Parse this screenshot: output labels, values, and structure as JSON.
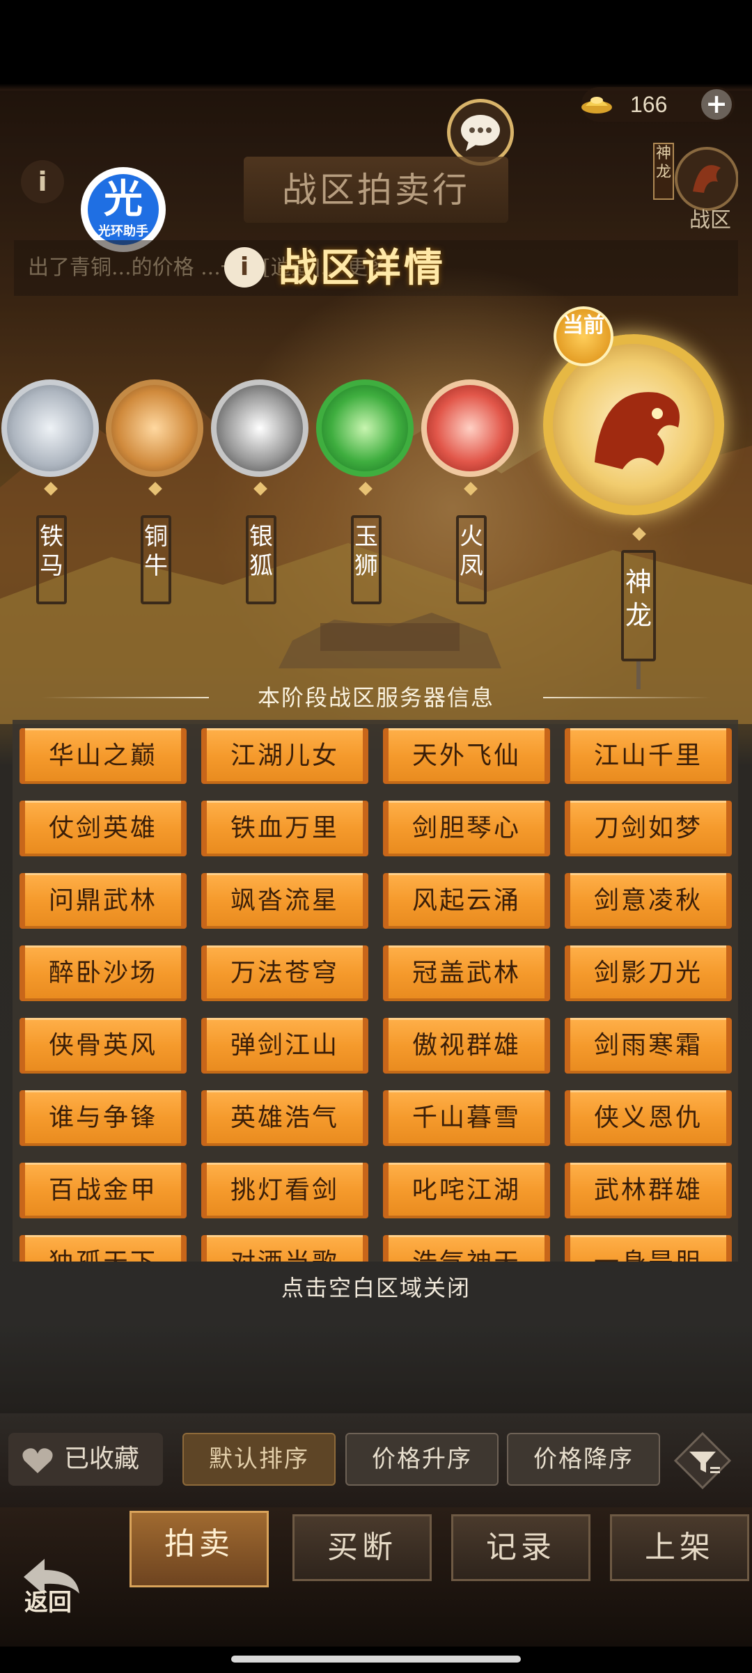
{
  "top_bar": {
    "gold_amount": "166",
    "plus_label": "+",
    "title": "战区拍卖行",
    "zone_vertical": "神龙",
    "zone_label": "战区",
    "info_label": "i",
    "logo_char": "光",
    "logo_sub": "光环助手"
  },
  "ticker": {
    "text": "出了青铜...的价格 ...一件[逍遥]... 更多"
  },
  "popup": {
    "title": "战区详情",
    "info_label": "i",
    "current_tag": "当前",
    "zones": [
      {
        "name": "铁马",
        "color": "#6a6a6a",
        "frame": "#c9cdd2"
      },
      {
        "name": "铜牛",
        "color": "#4e7a2e",
        "frame": "#c48a45"
      },
      {
        "name": "银狐",
        "color": "#3c7a96",
        "frame": "#c6c6c6"
      },
      {
        "name": "玉狮",
        "color": "#5a3a8a",
        "frame": "#3fae3f"
      },
      {
        "name": "火凤",
        "color": "#c66a1e",
        "frame": "#e2574a"
      },
      {
        "name": "神龙",
        "color": "#7a1e1e",
        "frame": "#e6b844"
      }
    ],
    "section_title": "本阶段战区服务器信息",
    "servers": [
      "华山之巅",
      "江湖儿女",
      "天外飞仙",
      "江山千里",
      "仗剑英雄",
      "铁血万里",
      "剑胆琴心",
      "刀剑如梦",
      "问鼎武林",
      "飒沓流星",
      "风起云涌",
      "剑意凌秋",
      "醉卧沙场",
      "万法苍穹",
      "冠盖武林",
      "剑影刀光",
      "侠骨英风",
      "弹剑江山",
      "傲视群雄",
      "剑雨寒霜",
      "谁与争锋",
      "英雄浩气",
      "千山暮雪",
      "侠义恩仇",
      "百战金甲",
      "挑灯看剑",
      "叱咤江湖",
      "武林群雄",
      "独孤天下",
      "对酒当歌",
      "浩气神天",
      "一身是胆"
    ],
    "close_hint": "点击空白区域关闭"
  },
  "controls": {
    "favorites_label": "已收藏",
    "sort_default": "默认排序",
    "sort_price_asc": "价格升序",
    "sort_price_desc": "价格降序"
  },
  "tabs": {
    "auction": "拍卖",
    "buyout": "买断",
    "records": "记录",
    "list": "上架",
    "back": "返回"
  }
}
